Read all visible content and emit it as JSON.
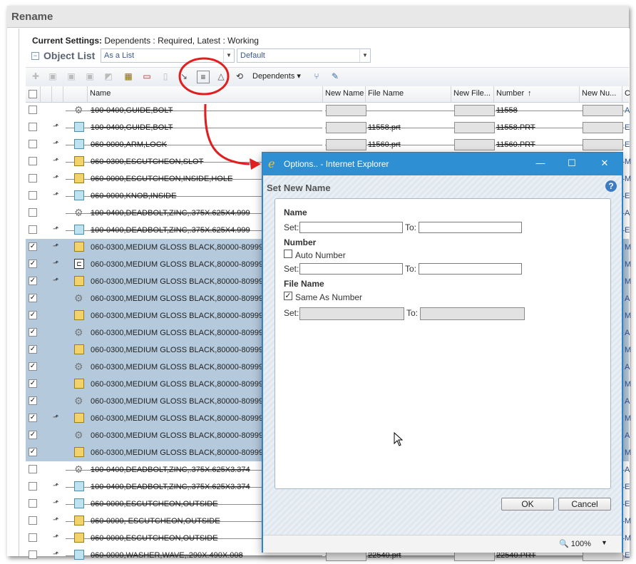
{
  "window": {
    "title": "Rename"
  },
  "settings": {
    "label": "Current Settings:",
    "text": "Dependents : Required, Latest : Working"
  },
  "object_list": {
    "title": "Object List",
    "view_select": "As a List",
    "config_select": "Default"
  },
  "toolbar": {
    "dependents_label": "Dependents ▾",
    "highlighted_tool": "set-new-name-icon"
  },
  "grid": {
    "headers": {
      "name": "Name",
      "new_name": "New Name",
      "file_name": "File Name",
      "new_file": "New File...",
      "number": "Number",
      "number_sort": "↑",
      "new_number": "New Nu...",
      "extra": "C"
    },
    "rows": [
      {
        "name": "100-0400,GUIDE,BOLT",
        "selected": false,
        "edit": false,
        "type": "gear",
        "file": "",
        "number": "11558",
        "extra": "A"
      },
      {
        "name": "100-0400,GUIDE,BOLT",
        "selected": false,
        "edit": true,
        "type": "part",
        "file": "11558.prt",
        "number": "11558.PRT",
        "extra": "E"
      },
      {
        "name": "060-0000,ARM,LOCK",
        "selected": false,
        "edit": true,
        "type": "part",
        "file": "11560.prt",
        "number": "11560.PRT",
        "extra": "E"
      },
      {
        "name": "060-0300,ESCUTCHEON,SLOT",
        "selected": false,
        "edit": true,
        "type": "asm",
        "file": "",
        "number": "",
        "extra": "M"
      },
      {
        "name": "060-0000,ESCUTCHEON,INSIDE,HOLE",
        "selected": false,
        "edit": true,
        "type": "asm",
        "file": "",
        "number": "",
        "extra": "M"
      },
      {
        "name": "060-0000,KNOB,INSIDE",
        "selected": false,
        "edit": true,
        "type": "part",
        "file": "",
        "number": "",
        "extra": "E"
      },
      {
        "name": "100-0400,DEADBOLT,ZINC,.375X.625X4.999",
        "selected": false,
        "edit": false,
        "type": "gear",
        "file": "",
        "number": "",
        "extra": "A"
      },
      {
        "name": "100-0400,DEADBOLT,ZINC,.375X.625X4.999",
        "selected": false,
        "edit": true,
        "type": "part",
        "file": "",
        "number": "",
        "extra": "E"
      },
      {
        "name": "060-0300,MEDIUM GLOSS BLACK,80000-80999",
        "selected": true,
        "edit": true,
        "type": "asm",
        "file": "",
        "number": "",
        "extra": "M"
      },
      {
        "name": "060-0300,MEDIUM GLOSS BLACK,80000-80999",
        "selected": true,
        "edit": true,
        "type": "drw",
        "file": "",
        "number": "",
        "extra": "M"
      },
      {
        "name": "060-0300,MEDIUM GLOSS BLACK,80000-80999",
        "selected": true,
        "edit": true,
        "type": "asm",
        "file": "",
        "number": "",
        "extra": "M"
      },
      {
        "name": "060-0300,MEDIUM GLOSS BLACK,80000-80999",
        "selected": true,
        "edit": false,
        "type": "gear",
        "file": "",
        "number": "",
        "extra": "A"
      },
      {
        "name": "060-0300,MEDIUM GLOSS BLACK,80000-80999",
        "selected": true,
        "edit": false,
        "type": "asm",
        "file": "",
        "number": "",
        "extra": "M"
      },
      {
        "name": "060-0300,MEDIUM GLOSS BLACK,80000-80999",
        "selected": true,
        "edit": false,
        "type": "gear",
        "file": "",
        "number": "",
        "extra": "A"
      },
      {
        "name": "060-0300,MEDIUM GLOSS BLACK,80000-80999",
        "selected": true,
        "edit": false,
        "type": "asm",
        "file": "",
        "number": "",
        "extra": "M"
      },
      {
        "name": "060-0300,MEDIUM GLOSS BLACK,80000-80999",
        "selected": true,
        "edit": false,
        "type": "gear",
        "file": "",
        "number": "",
        "extra": "A"
      },
      {
        "name": "060-0300,MEDIUM GLOSS BLACK,80000-80999",
        "selected": true,
        "edit": false,
        "type": "asm",
        "file": "",
        "number": "",
        "extra": "M"
      },
      {
        "name": "060-0300,MEDIUM GLOSS BLACK,80000-80999",
        "selected": true,
        "edit": false,
        "type": "gear",
        "file": "",
        "number": "",
        "extra": "A"
      },
      {
        "name": "060-0300,MEDIUM GLOSS BLACK,80000-80999",
        "selected": true,
        "edit": true,
        "type": "asm",
        "file": "",
        "number": "",
        "extra": "M"
      },
      {
        "name": "060-0300,MEDIUM GLOSS BLACK,80000-80999",
        "selected": true,
        "edit": false,
        "type": "gear",
        "file": "",
        "number": "",
        "extra": "A"
      },
      {
        "name": "060-0300,MEDIUM GLOSS BLACK,80000-80999",
        "selected": true,
        "edit": false,
        "type": "asm",
        "file": "",
        "number": "",
        "extra": "M"
      },
      {
        "name": "100-0400,DEADBOLT,ZINC,.375X.625X3.374",
        "selected": false,
        "edit": false,
        "type": "gear",
        "file": "",
        "number": "",
        "extra": "A"
      },
      {
        "name": "100-0400,DEADBOLT,ZINC,.375X.625X3.374",
        "selected": false,
        "edit": true,
        "type": "part",
        "file": "",
        "number": "",
        "extra": "E"
      },
      {
        "name": "060-0000,ESCUTCHEON,OUTSIDE",
        "selected": false,
        "edit": true,
        "type": "part",
        "file": "",
        "number": "",
        "extra": "E"
      },
      {
        "name": "060-0000, ESCUTCHEON,OUTSIDE",
        "selected": false,
        "edit": true,
        "type": "asm",
        "file": "",
        "number": "",
        "extra": "M"
      },
      {
        "name": "060-0000,ESCUTCHEON,OUTSIDE",
        "selected": false,
        "edit": true,
        "type": "asm",
        "file": "",
        "number": "",
        "extra": "M"
      },
      {
        "name": "060-0000,WASHER,WAVE,.290X.490X.008",
        "selected": false,
        "edit": true,
        "type": "part",
        "file": "22540.prt",
        "number": "22540.PRT",
        "extra": "E"
      }
    ]
  },
  "dialog": {
    "title": "Options.. - Internet Explorer",
    "heading": "Set New Name",
    "name_section": "Name",
    "number_section": "Number",
    "auto_number": "Auto Number",
    "auto_number_checked": false,
    "file_section": "File Name",
    "same_as_number": "Same As Number",
    "same_as_number_checked": true,
    "set_label": "Set:",
    "to_label": "To:",
    "ok": "OK",
    "cancel": "Cancel",
    "zoom": "100%"
  },
  "colors": {
    "selection": "#b4c9db",
    "dialog_title": "#2f8fd3",
    "annotation": "#e02020"
  }
}
